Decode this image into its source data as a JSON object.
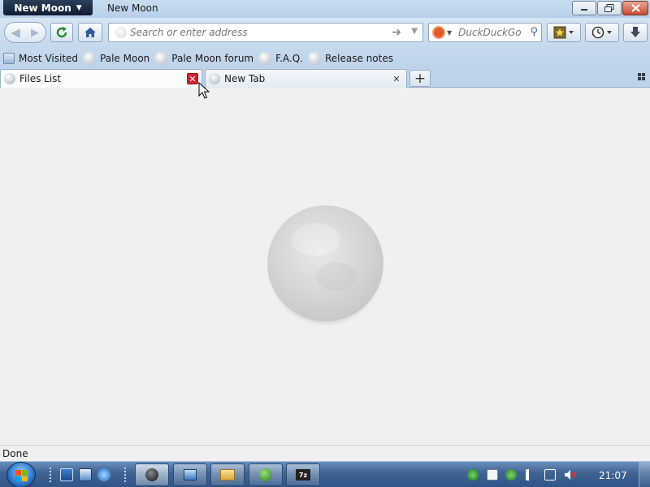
{
  "window": {
    "app_menu_label": "New Moon",
    "title": "New Moon"
  },
  "navbar": {
    "address_placeholder": "Search or enter address",
    "search_engine": "DuckDuckGo",
    "search_placeholder": "DuckDuckGo"
  },
  "bookmarks": {
    "items": [
      {
        "label": "Most Visited",
        "icon": "most-visited-icon"
      },
      {
        "label": "Pale Moon",
        "icon": "globe-icon"
      },
      {
        "label": "Pale Moon forum",
        "icon": "globe-icon"
      },
      {
        "label": "F.A.Q.",
        "icon": "globe-icon"
      },
      {
        "label": "Release notes",
        "icon": "globe-icon"
      }
    ]
  },
  "tabs": [
    {
      "label": "Files List",
      "selected": true
    },
    {
      "label": "New Tab",
      "selected": false
    }
  ],
  "status": {
    "text": "Done"
  },
  "taskbar": {
    "clock": "21:07",
    "apps": [
      "pale-moon",
      "remote-desktop",
      "file-explorer",
      "network-app",
      "7-zip"
    ]
  },
  "colors": {
    "chrome_blue": "#c5d8ec",
    "content_bg": "#f0f0f0",
    "tab_close_hover": "#d3222c"
  }
}
